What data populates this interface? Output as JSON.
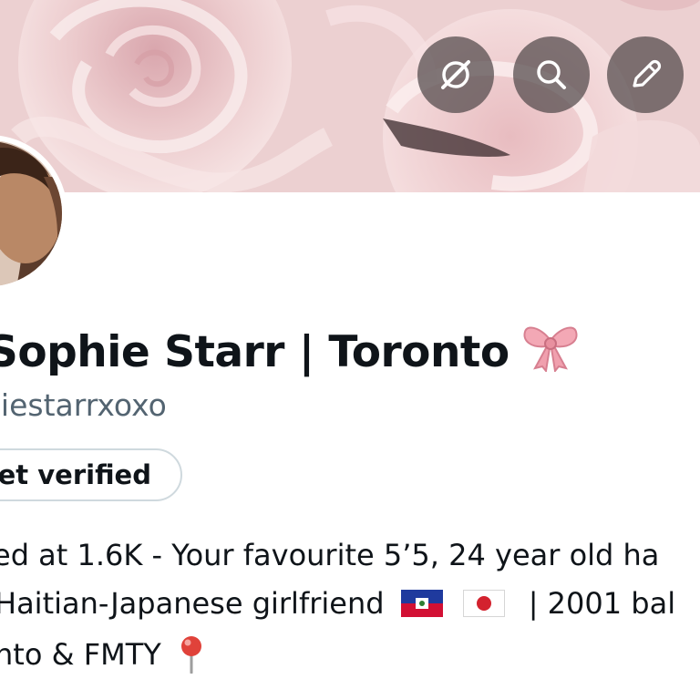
{
  "header": {
    "buttons": [
      {
        "icon": "grok-icon",
        "label": "Grok"
      },
      {
        "icon": "search-icon",
        "label": "Search"
      },
      {
        "icon": "edit-icon",
        "label": "Edit"
      }
    ]
  },
  "banner": {
    "description_icon": "pink-roses-banner"
  },
  "profile": {
    "display_name": "Sophie Starr | Toronto",
    "display_name_emoji": "ribbon-bow-icon",
    "handle": "hiestarrxoxo",
    "verify_button_label": "et verified",
    "bio_lines": [
      "ed at 1.6K - Your favourite 5’5, 24 year old ha",
      "Haitian-Japanese girlfriend",
      "| 2001 bal",
      "nto & FMTY"
    ],
    "bio_icons": [
      "haiti-flag-icon",
      "japan-flag-icon",
      "round-pushpin-icon"
    ]
  },
  "colors": {
    "text_primary": "#0f1419",
    "text_secondary": "#536471",
    "button_border": "#cfd9de",
    "header_button_bg": "#50484a",
    "banner_pink": "#e6c0c3"
  }
}
